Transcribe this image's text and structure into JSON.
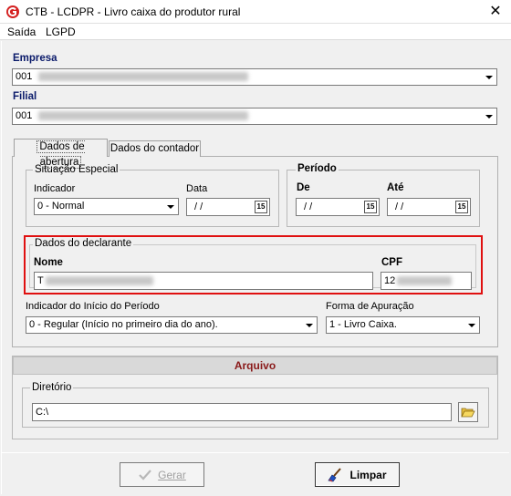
{
  "window": {
    "title": "CTB - LCDPR - Livro caixa do produtor rural",
    "close_glyph": "✕"
  },
  "menu": {
    "items": [
      "Saída",
      "LGPD"
    ]
  },
  "empresa": {
    "label": "Empresa",
    "value": "001"
  },
  "filial": {
    "label": "Filial",
    "value": "001"
  },
  "tabs": [
    {
      "label": "Dados de abertura",
      "active": true
    },
    {
      "label": "Dados do contador",
      "active": false
    }
  ],
  "situacao": {
    "title": "Situação Especial",
    "indicador_label": "Indicador",
    "indicador_value": "0 - Normal",
    "data_label": "Data",
    "data_value": "/ /",
    "cal_glyph": "15"
  },
  "periodo": {
    "title": "Período",
    "de_label": "De",
    "de_value": "/ /",
    "ate_label": "Até",
    "ate_value": "/ /"
  },
  "declarante": {
    "title": "Dados do declarante",
    "nome_label": "Nome",
    "nome_value": "T",
    "cpf_label": "CPF",
    "cpf_value": "12"
  },
  "indicador_inicio": {
    "label": "Indicador do Início do Período",
    "value": "0 - Regular (Início no primeiro dia do ano)."
  },
  "forma_apuracao": {
    "label": "Forma de Apuração",
    "value": "1 - Livro Caixa."
  },
  "arquivo": {
    "header": "Arquivo",
    "diretorio_label": "Diretório",
    "diretorio_value": "C:\\"
  },
  "buttons": {
    "gerar": "Gerar",
    "limpar": "Limpar"
  },
  "colors": {
    "highlight": "#e01010",
    "label_blue": "#0a1a6a",
    "section_title": "#8a1a1a"
  }
}
